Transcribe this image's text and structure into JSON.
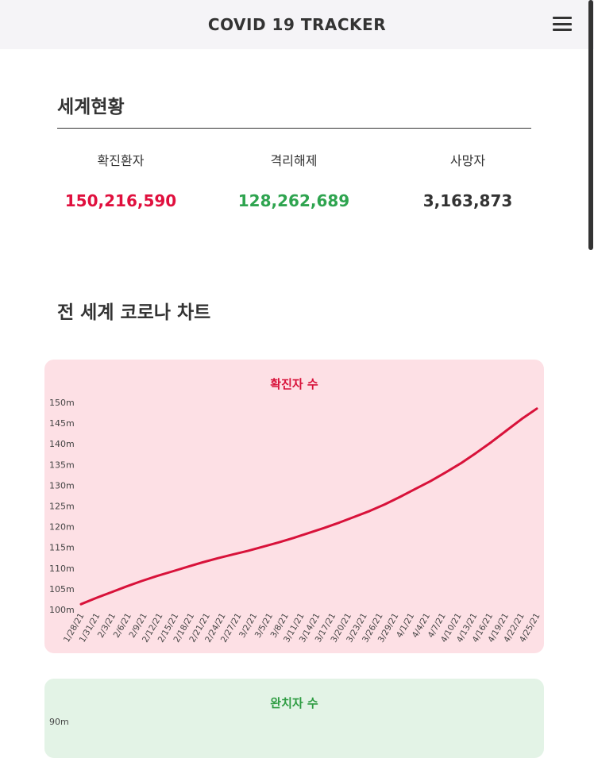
{
  "header": {
    "title": "COVID 19  TRACKER"
  },
  "world": {
    "title": "세계현황",
    "stats": [
      {
        "label": "확진환자",
        "value": "150,216,590",
        "color": "#e0103e"
      },
      {
        "label": "격리해제",
        "value": "128,262,689",
        "color": "#2ea44f"
      },
      {
        "label": "사망자",
        "value": "3,163,873",
        "color": "#333333"
      }
    ]
  },
  "charts_section": {
    "title": "전 세계 코로나 차트"
  },
  "colors": {
    "confirmed_bg": "#fde0e5",
    "confirmed_line": "#d8123a",
    "recovered_bg": "#e3f3e6",
    "recovered_title": "#2e9c42"
  },
  "chart_data": [
    {
      "type": "line",
      "title": "확진자 수",
      "ylabel": "",
      "xlabel": "",
      "ylim": [
        100,
        150
      ],
      "y_ticks": [
        "150m",
        "145m",
        "140m",
        "135m",
        "130m",
        "125m",
        "120m",
        "115m",
        "110m",
        "105m",
        "100m"
      ],
      "x_ticks": [
        "1/28/21",
        "1/31/21",
        "2/3/21",
        "2/6/21",
        "2/9/21",
        "2/12/21",
        "2/15/21",
        "2/18/21",
        "2/21/21",
        "2/24/21",
        "2/27/21",
        "3/2/21",
        "3/5/21",
        "3/8/21",
        "3/11/21",
        "3/14/21",
        "3/17/21",
        "3/20/21",
        "3/23/21",
        "3/26/21",
        "3/29/21",
        "4/1/21",
        "4/4/21",
        "4/7/21",
        "4/10/21",
        "4/13/21",
        "4/16/21",
        "4/19/21",
        "4/22/21",
        "4/25/21"
      ],
      "series": [
        {
          "values": [
            101.3,
            102.8,
            104.2,
            105.6,
            106.9,
            108.1,
            109.2,
            110.3,
            111.4,
            112.4,
            113.3,
            114.2,
            115.2,
            116.2,
            117.3,
            118.5,
            119.7,
            121.0,
            122.4,
            123.8,
            125.4,
            127.2,
            129.1,
            131.0,
            133.1,
            135.3,
            137.8,
            140.4,
            143.2,
            146.0
          ],
          "end_value": 148.5
        }
      ],
      "grid": false,
      "legend": "none"
    },
    {
      "type": "line",
      "title": "완치자 수",
      "y_ticks": [
        "90m"
      ],
      "series": []
    }
  ]
}
